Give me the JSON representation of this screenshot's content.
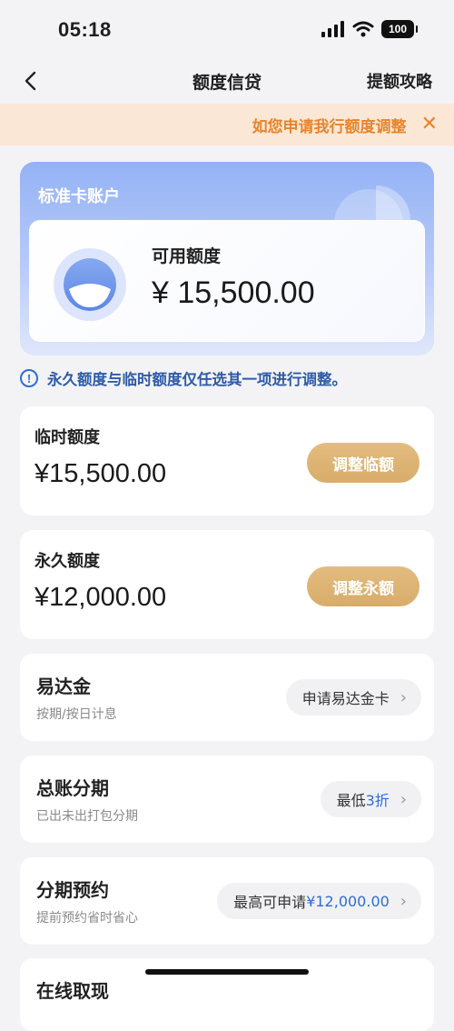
{
  "status": {
    "time": "05:18",
    "battery": "100"
  },
  "nav": {
    "title": "额度信贷",
    "right": "提额攻略"
  },
  "promo": {
    "text": "如您申请我行额度调整",
    "close": "✕"
  },
  "account": {
    "title": "标准卡账户",
    "available_label": "可用额度",
    "available_amount": "¥ 15,500.00"
  },
  "notice": {
    "icon": "!",
    "text": "永久额度与临时额度仅任选其一项进行调整。"
  },
  "limits": [
    {
      "label": "临时额度",
      "amount": "¥15,500.00",
      "button": "调整临额"
    },
    {
      "label": "永久额度",
      "amount": "¥12,000.00",
      "button": "调整永额"
    }
  ],
  "services": [
    {
      "title": "易达金",
      "sub": "按期/按日计息",
      "pill_text": "申请易达金卡"
    },
    {
      "title": "总账分期",
      "sub": "已出未出打包分期",
      "pill_prefix": "最低",
      "pill_highlight": "3折"
    },
    {
      "title": "分期预约",
      "sub": "提前预约省时省心",
      "pill_prefix": "最高可申请 ",
      "pill_highlight": "¥12,000.00"
    }
  ],
  "partial": {
    "title": "在线取现"
  },
  "colors": {
    "accent_blue": "#2e6dd6",
    "gold": "#dcb174",
    "promo_orange": "#e8842b"
  }
}
